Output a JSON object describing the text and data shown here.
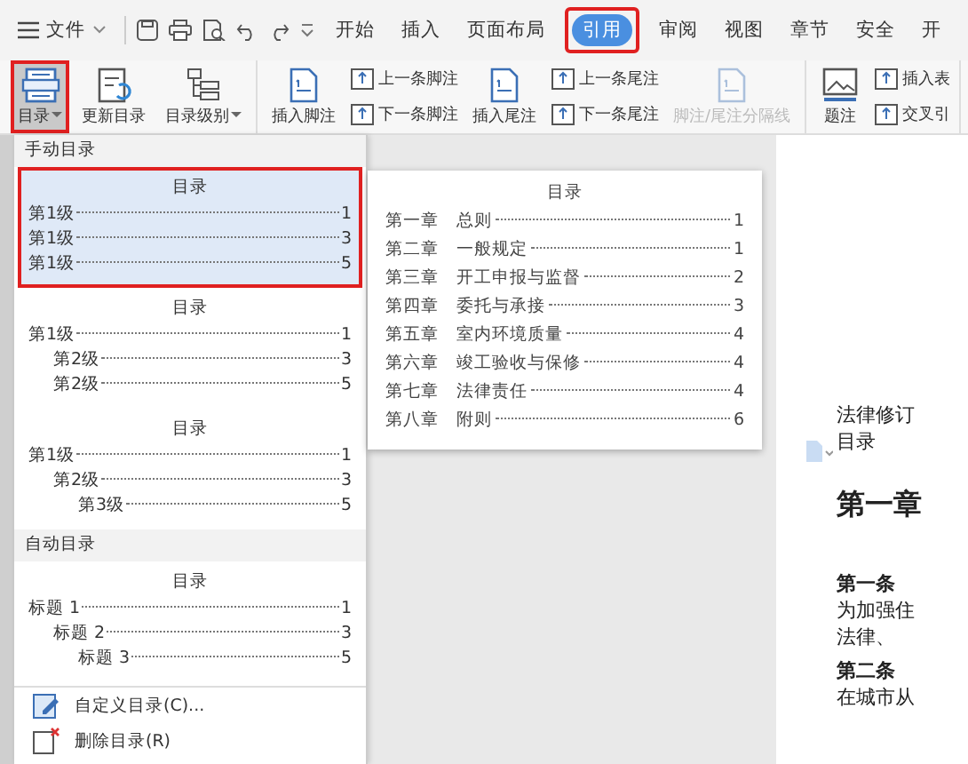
{
  "menu_bar": {
    "file_menu": "文件",
    "tabs": [
      {
        "label": "开始",
        "selected": false
      },
      {
        "label": "插入",
        "selected": false
      },
      {
        "label": "页面布局",
        "selected": false
      },
      {
        "label": "引用",
        "selected": true
      },
      {
        "label": "审阅",
        "selected": false
      },
      {
        "label": "视图",
        "selected": false
      },
      {
        "label": "章节",
        "selected": false
      },
      {
        "label": "安全",
        "selected": false
      },
      {
        "label": "开",
        "selected": false
      }
    ]
  },
  "ribbon": {
    "groups": [
      {
        "kind": "large",
        "items": [
          {
            "label": "目录",
            "selected": true,
            "caret": true
          },
          {
            "label": "更新目录",
            "selected": false,
            "caret": false
          },
          {
            "label": "目录级别",
            "selected": false,
            "caret": true
          }
        ]
      },
      {
        "kind": "mixed",
        "items": [
          {
            "kind": "large",
            "label": "插入脚注",
            "disabled": false
          },
          {
            "kind": "pair",
            "labels": [
              "上一条脚注",
              "下一条脚注"
            ]
          },
          {
            "kind": "large",
            "label": "插入尾注",
            "disabled": false
          },
          {
            "kind": "pair",
            "labels": [
              "上一条尾注",
              "下一条尾注"
            ]
          },
          {
            "kind": "large",
            "label": "脚注/尾注分隔线",
            "disabled": true
          }
        ]
      },
      {
        "kind": "mixed",
        "items": [
          {
            "kind": "large",
            "label": "题注",
            "disabled": false
          },
          {
            "kind": "pair",
            "labels": [
              "插入表",
              "交叉引"
            ]
          }
        ]
      }
    ]
  },
  "toc_menu": {
    "sections": [
      {
        "heading": "手动目录",
        "templates": [
          {
            "title": "目录",
            "selected": true,
            "entries": [
              {
                "label": "第1级",
                "page": "1"
              },
              {
                "label": "第1级",
                "page": "3"
              },
              {
                "label": "第1级",
                "page": "5"
              }
            ]
          },
          {
            "title": "目录",
            "selected": false,
            "entries": [
              {
                "label": "第1级",
                "page": "1",
                "children": [
                  {
                    "label": "第2级",
                    "page": "3"
                  },
                  {
                    "label": "第2级",
                    "page": "5"
                  }
                ]
              }
            ]
          },
          {
            "title": "目录",
            "selected": false,
            "entries": [
              {
                "label": "第1级",
                "page": "1",
                "children": [
                  {
                    "label": "第2级",
                    "page": "3",
                    "children": [
                      {
                        "label": "第3级",
                        "page": "5"
                      }
                    ]
                  }
                ]
              }
            ]
          }
        ]
      },
      {
        "heading": "自动目录",
        "templates": [
          {
            "title": "目录",
            "selected": false,
            "entries": [
              {
                "label": "标题 1",
                "page": "1",
                "children": [
                  {
                    "label": "标题 2",
                    "page": "3",
                    "children": [
                      {
                        "label": "标题 3",
                        "page": "5"
                      }
                    ]
                  }
                ]
              }
            ]
          }
        ]
      }
    ],
    "actions": [
      {
        "label": "自定义目录(C)..."
      },
      {
        "label": "删除目录(R)"
      }
    ]
  },
  "preview": {
    "title": "目录",
    "rows": [
      {
        "chapter": "第一章",
        "name": "总则",
        "page": "1"
      },
      {
        "chapter": "第二章",
        "name": "一般规定",
        "page": "1"
      },
      {
        "chapter": "第三章",
        "name": "开工申报与监督",
        "page": "2"
      },
      {
        "chapter": "第四章",
        "name": "委托与承接",
        "page": "3"
      },
      {
        "chapter": "第五章",
        "name": "室内环境质量",
        "page": "4"
      },
      {
        "chapter": "第六章",
        "name": "竣工验收与保修",
        "page": "4"
      },
      {
        "chapter": "第七章",
        "name": "法律责任",
        "page": "4"
      },
      {
        "chapter": "第八章",
        "name": "附则",
        "page": "6"
      }
    ]
  },
  "document": {
    "blocks": [
      {
        "kind": "line",
        "text": "法律修订"
      },
      {
        "kind": "line",
        "text": "目录"
      },
      {
        "kind": "chapter",
        "text": "第一章"
      },
      {
        "kind": "article",
        "text": "第一条"
      },
      {
        "kind": "line",
        "text": "为加强住"
      },
      {
        "kind": "line",
        "text": "法律、"
      },
      {
        "kind": "article",
        "text": "第二条"
      },
      {
        "kind": "line",
        "text": "在城市从"
      }
    ]
  }
}
